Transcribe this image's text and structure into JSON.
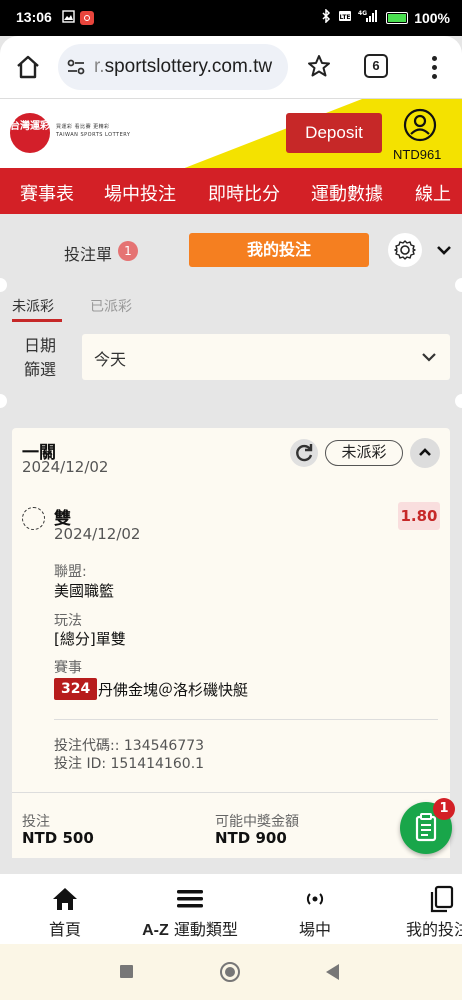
{
  "status_bar": {
    "time": "13:06",
    "network": "4G",
    "battery": "100%"
  },
  "browser": {
    "url_dim": "r.",
    "url_main": "sportslottery.com.tw",
    "tab_count": "6"
  },
  "site": {
    "logo_text": "台灣運彩",
    "logo_sub_line1": "買運彩 看比賽 更精彩",
    "logo_sub_line2": "TAIWAN SPORTS LOTTERY",
    "deposit_label": "Deposit",
    "balance": "NTD961"
  },
  "nav": {
    "items": [
      "賽事表",
      "場中投注",
      "即時比分",
      "運動數據",
      "線上"
    ]
  },
  "bet_header": {
    "betslip_label": "投注單",
    "betslip_count": "1",
    "mybets_label": "我的投注"
  },
  "filter": {
    "tabs": [
      "未派彩",
      "已派彩"
    ],
    "date_label_line1": "日期",
    "date_label_line2": "篩選",
    "date_value": "今天"
  },
  "bet_card": {
    "type": "一關",
    "date": "2024/12/02",
    "status": "未派彩",
    "selection": "雙",
    "selection_date": "2024/12/02",
    "odds": "1.80",
    "league_label": "聯盟:",
    "league_value": "美國職籃",
    "market_label": "玩法",
    "market_value": "[總分]單雙",
    "event_label": "賽事",
    "match_id": "324",
    "match_name": "丹佛金塊＠洛杉磯快艇",
    "bet_code": "投注代碼:: 134546773",
    "bet_id": "投注 ID: 151414160.1",
    "stake_label": "投注",
    "stake_value": "NTD 500",
    "payout_label": "可能中獎金額",
    "payout_value": "NTD 900"
  },
  "fab": {
    "badge": "1"
  },
  "bottom_nav": {
    "items": [
      {
        "label": "首頁",
        "icon": "home-icon"
      },
      {
        "label_bold": "A-Z",
        "label": " 運動類型",
        "icon": "menu-icon"
      },
      {
        "label": "場中",
        "icon": "live-icon"
      },
      {
        "label": "我的投注",
        "icon": "copy-icon"
      }
    ]
  }
}
